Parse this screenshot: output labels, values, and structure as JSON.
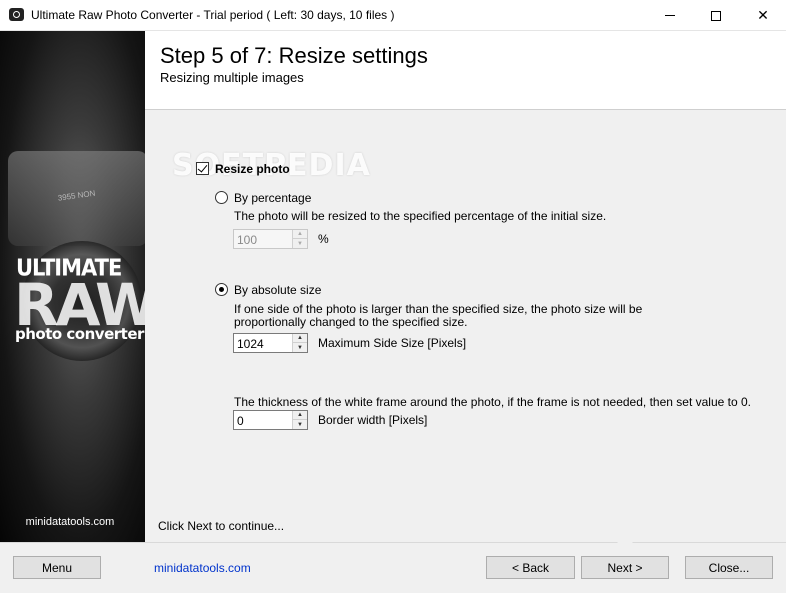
{
  "window": {
    "title": "Ultimate Raw Photo Converter - Trial period ( Left: 30 days, 10 files )",
    "minimize": "—",
    "maximize": "☐",
    "close": "✕"
  },
  "brand": {
    "line1": "ULTIMATE",
    "line2": "RAW",
    "line3": "photo converter",
    "url": "minidatatools.com",
    "camera_plate": "3955 NON"
  },
  "header": {
    "title": "Step 5 of 7: Resize settings",
    "subtitle": "Resizing multiple images"
  },
  "watermark": "SOFTPEDIA",
  "resize": {
    "checkbox_label": "Resize photo",
    "checked": true,
    "by_percentage": {
      "label": "By percentage",
      "selected": false,
      "description": "The photo will be resized to the specified percentage of the initial size.",
      "value": "100",
      "unit": "%"
    },
    "by_absolute": {
      "label": "By absolute size",
      "selected": true,
      "description_line1": "If one side of the photo is larger than the specified size, the photo size will be",
      "description_line2": "proportionally changed to the specified size.",
      "value": "1024",
      "unit_label": "Maximum Side Size [Pixels]"
    },
    "border": {
      "description": "The thickness of the white frame around the photo, if the frame is not needed, then set value to 0.",
      "value": "0",
      "unit_label": "Border width [Pixels]"
    }
  },
  "continue_text": "Click Next to continue...",
  "footer": {
    "menu": "Menu",
    "link": "minidatatools.com",
    "back": "< Back",
    "next": "Next >",
    "close": "Close..."
  },
  "colors": {
    "link": "#0033cc",
    "content_bg": "#f0f0f0"
  }
}
